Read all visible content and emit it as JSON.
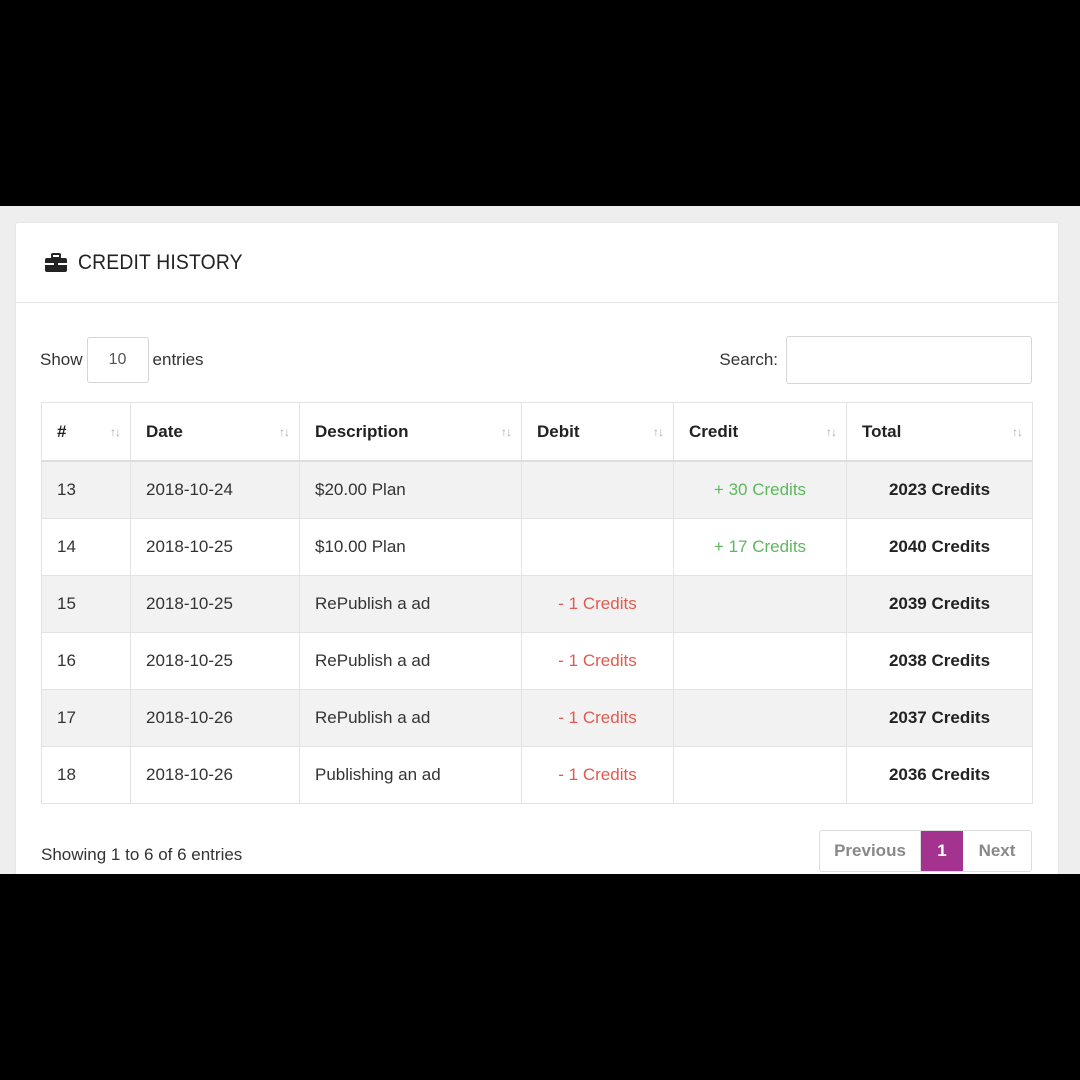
{
  "panel": {
    "title": "CREDIT HISTORY",
    "icon": "briefcase-icon"
  },
  "controls": {
    "show_label": "Show",
    "page_length": "10",
    "entries_label": "entries",
    "search_label": "Search:",
    "search_value": ""
  },
  "table": {
    "columns": [
      "#",
      "Date",
      "Description",
      "Debit",
      "Credit",
      "Total"
    ],
    "rows": [
      {
        "id": "13",
        "date": "2018-10-24",
        "description": "$20.00 Plan",
        "debit": "",
        "credit": "+ 30 Credits",
        "total": "2023 Credits"
      },
      {
        "id": "14",
        "date": "2018-10-25",
        "description": "$10.00 Plan",
        "debit": "",
        "credit": "+ 17 Credits",
        "total": "2040 Credits"
      },
      {
        "id": "15",
        "date": "2018-10-25",
        "description": "RePublish a ad",
        "debit": "- 1 Credits",
        "credit": "",
        "total": "2039 Credits"
      },
      {
        "id": "16",
        "date": "2018-10-25",
        "description": "RePublish a ad",
        "debit": "- 1 Credits",
        "credit": "",
        "total": "2038 Credits"
      },
      {
        "id": "17",
        "date": "2018-10-26",
        "description": "RePublish a ad",
        "debit": "- 1 Credits",
        "credit": "",
        "total": "2037 Credits"
      },
      {
        "id": "18",
        "date": "2018-10-26",
        "description": "Publishing an ad",
        "debit": "- 1 Credits",
        "credit": "",
        "total": "2036 Credits"
      }
    ]
  },
  "footer": {
    "info": "Showing 1 to 6 of 6 entries",
    "prev_label": "Previous",
    "current_page": "1",
    "next_label": "Next"
  },
  "colors": {
    "accent": "#a3338f",
    "debit": "#e05a4f",
    "credit": "#5cb85c"
  }
}
